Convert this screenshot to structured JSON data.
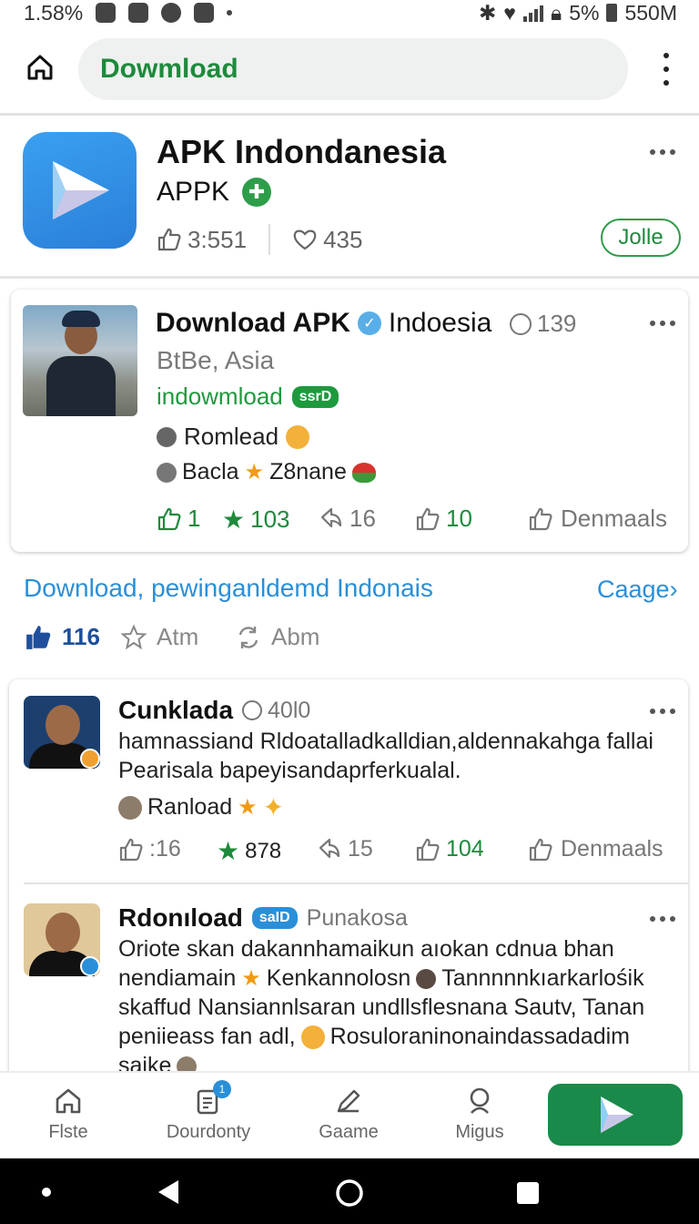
{
  "status_bar": {
    "time": "1.58%",
    "battery": "5%",
    "network": "550M"
  },
  "header": {
    "url_text": "Dowmload"
  },
  "app": {
    "title": "APK Indondanesia",
    "subtitle": "APPK",
    "likes": "3:551",
    "hearts": "435",
    "join_label": "Jolle"
  },
  "post": {
    "title": "Download APK",
    "title_suffix": "Indoesia",
    "count": "139",
    "subtitle": "BtBe, Asia",
    "link_text": "indowmload",
    "link_tag": "ssrD",
    "line1": "Romlead",
    "line2_a": "Bacla",
    "line2_b": "Z8nane",
    "actions": {
      "like": "1",
      "star": "103",
      "share": "16",
      "thumb": "10",
      "download": "Denmaals"
    }
  },
  "section": {
    "link_text": "Download, pewinganldemd Indonais",
    "change_text": "Caage",
    "reactions": {
      "likes": "116",
      "star_label": "Atm",
      "repost_label": "Abm"
    }
  },
  "comments": [
    {
      "name": "Cunklada",
      "meta": "40l0",
      "text": "hamnassiand Rldoatalladkalldian,aldennakahga fallai Pearisala bapeyisandaprferkualal.",
      "line": "Ranload",
      "actions": {
        "like": ":16",
        "star": "878",
        "share": "15",
        "thumb": "104",
        "download": "Denmaals"
      }
    },
    {
      "name": "Rdonıload",
      "tag": "saID",
      "meta": "Punakosa",
      "line1": "Oriote skan dakannhamaikun aıokan cdnua bhan",
      "line2_a": "nendiamain",
      "line2_b": "Kenkannolosn",
      "line2_c": "Tannnnnkıarkarlośik",
      "line3": "skaffud Nansiannlsaran undllsflesnana Sautv, Tanan",
      "line4_a": "peniieass fan adl,",
      "line4_b": "Rosuloraninonaindassadadim",
      "line5": "saike"
    }
  ],
  "bottom_nav": {
    "items": [
      {
        "label": "Flste"
      },
      {
        "label": "Dourdonty",
        "badge": "1"
      },
      {
        "label": "Gaame"
      },
      {
        "label": "Migus"
      }
    ]
  },
  "colors": {
    "accent_green": "#1e8a3c",
    "link_blue": "#2a8fd8",
    "play_button": "#1a8a4a"
  },
  "icons": {
    "home": "home-outline-icon",
    "menu": "kebab-menu-icon",
    "app": "play-arrow-icon",
    "like": "thumb-up-icon",
    "heart": "heart-icon",
    "star": "star-icon",
    "share": "share-icon",
    "download": "download-icon"
  }
}
